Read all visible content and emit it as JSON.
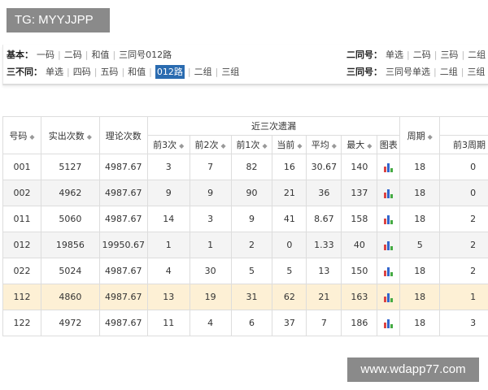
{
  "watermarks": {
    "top": "TG: MYYJJPP",
    "bottom": "www.wdapp77.com"
  },
  "nav": {
    "left": [
      {
        "label": "基本：",
        "items": [
          "一码",
          "二码",
          "和值",
          "三同号012路"
        ]
      },
      {
        "label": "三不同：",
        "items": [
          "单选",
          "四码",
          "五码",
          "和值",
          "012路",
          "二组",
          "三组"
        ],
        "selected": "012路"
      }
    ],
    "right": [
      {
        "label": "二同号：",
        "items": [
          "单选",
          "二码",
          "三码",
          "二组"
        ]
      },
      {
        "label": "三同号：",
        "items": [
          "三同号单选",
          "二组",
          "三组"
        ]
      }
    ]
  },
  "table": {
    "headers": {
      "number": "号码",
      "actual": "实出次数",
      "theory": "理论次数",
      "group": "近三次遗漏",
      "prev3": "前3次",
      "prev2": "前2次",
      "prev1": "前1次",
      "current": "当前",
      "avg": "平均",
      "max": "最大",
      "chart": "图表",
      "period": "周期",
      "prev3period": "前3周期"
    },
    "sort_icon": "sort-arrows-icon",
    "highlight_color": "#fdf0d5",
    "rows": [
      [
        "001",
        "5127",
        "4987.67",
        "3",
        "7",
        "82",
        "16",
        "30.67",
        "140",
        "18",
        "0"
      ],
      [
        "002",
        "4962",
        "4987.67",
        "9",
        "9",
        "90",
        "21",
        "36",
        "137",
        "18",
        "0"
      ],
      [
        "011",
        "5060",
        "4987.67",
        "14",
        "3",
        "9",
        "41",
        "8.67",
        "158",
        "18",
        "2"
      ],
      [
        "012",
        "19856",
        "19950.67",
        "1",
        "1",
        "2",
        "0",
        "1.33",
        "40",
        "5",
        "2"
      ],
      [
        "022",
        "5024",
        "4987.67",
        "4",
        "30",
        "5",
        "5",
        "13",
        "150",
        "18",
        "2"
      ],
      [
        "112",
        "4860",
        "4987.67",
        "13",
        "19",
        "31",
        "62",
        "21",
        "163",
        "18",
        "1"
      ],
      [
        "122",
        "4972",
        "4987.67",
        "11",
        "4",
        "6",
        "37",
        "7",
        "186",
        "18",
        "3"
      ]
    ],
    "highlighted_row": "112"
  }
}
